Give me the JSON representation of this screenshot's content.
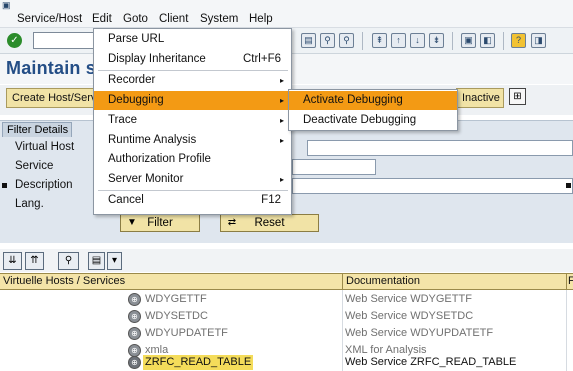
{
  "menubar": {
    "items": [
      {
        "label": "Service/Host"
      },
      {
        "label": "Edit"
      },
      {
        "label": "Goto"
      },
      {
        "label": "Client"
      },
      {
        "label": "System"
      },
      {
        "label": "Help"
      }
    ]
  },
  "toolbar": {
    "icons": [
      "enter-icon",
      "command-field",
      "print-icon",
      "find-icon",
      "find-next-icon",
      "first-page-icon",
      "prev-page-icon",
      "next-page-icon",
      "last-page-icon",
      "new-session-icon",
      "shortcut-icon",
      "help-icon",
      "customize-icon"
    ]
  },
  "title": {
    "text": "Maintain s"
  },
  "app_toolbar": {
    "create_label": "Create Host/Serv",
    "inactive_label": "Inactive"
  },
  "filter": {
    "tab_label": "Filter Details",
    "fields": [
      {
        "label": "Virtual Host"
      },
      {
        "label": "Service"
      },
      {
        "label": "Description"
      },
      {
        "label": "Lang."
      }
    ],
    "filter_button": "Filter",
    "reset_button": "Reset"
  },
  "table": {
    "columns": [
      "Virtuelle Hosts / Services",
      "Documentation",
      "F"
    ],
    "rows": [
      {
        "name": "WDYGETTF",
        "doc": "Web Service WDYGETTF",
        "selected": false
      },
      {
        "name": "WDYSETDC",
        "doc": "Web Service WDYSETDC",
        "selected": false
      },
      {
        "name": "WDYUPDATETF",
        "doc": "Web Service WDYUPDATETF",
        "selected": false
      },
      {
        "name": "xmla",
        "doc": "XML for Analysis",
        "selected": false
      },
      {
        "name": "ZRFC_READ_TABLE",
        "doc": "Web Service ZRFC_READ_TABLE",
        "selected": true
      }
    ]
  },
  "edit_menu": {
    "items": [
      {
        "label": "Parse URL",
        "accel": "",
        "submenu": false
      },
      {
        "label": "Display Inheritance",
        "accel": "Ctrl+F6",
        "submenu": false
      },
      {
        "label": "Recorder",
        "accel": "",
        "submenu": true
      },
      {
        "label": "Debugging",
        "accel": "",
        "submenu": true,
        "highlighted": true
      },
      {
        "label": "Trace",
        "accel": "",
        "submenu": true
      },
      {
        "label": "Runtime Analysis",
        "accel": "",
        "submenu": true
      },
      {
        "label": "Authorization Profile",
        "accel": "",
        "submenu": false
      },
      {
        "label": "Server Monitor",
        "accel": "",
        "submenu": true
      },
      {
        "label": "Cancel",
        "accel": "F12",
        "submenu": false
      }
    ]
  },
  "debug_submenu": {
    "items": [
      {
        "label": "Activate Debugging",
        "highlighted": true
      },
      {
        "label": "Deactivate Debugging",
        "highlighted": false
      }
    ]
  },
  "colors": {
    "highlight": "#f39a14",
    "button": "#f1e3a6",
    "title": "#244e86"
  }
}
